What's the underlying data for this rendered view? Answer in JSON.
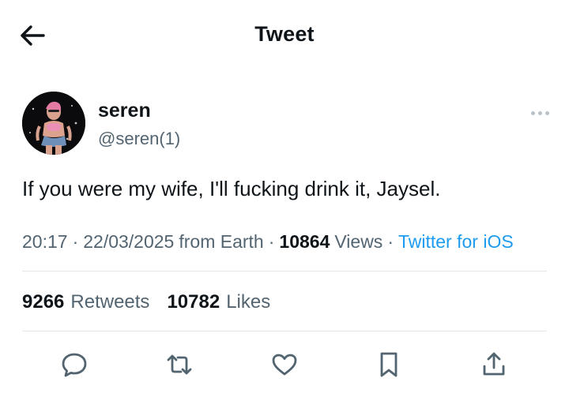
{
  "header": {
    "back_icon": "arrow-left-icon",
    "title": "Tweet"
  },
  "author": {
    "display_name": "seren",
    "handle": "@seren(1)",
    "avatar": "profile-photo"
  },
  "tweet": {
    "text": "If you were my wife, I'll fucking drink it, Jaysel."
  },
  "meta": {
    "time": "20:17",
    "separator": "·",
    "date": "22/03/2025",
    "location": "from Earth",
    "views_count": "10864",
    "views_label": "Views",
    "source": "Twitter for iOS",
    "source_color": "#1d9bf0"
  },
  "stats": {
    "retweets_count": "9266",
    "retweets_label": "Retweets",
    "likes_count": "10782",
    "likes_label": "Likes"
  },
  "actions": [
    {
      "icon": "reply-icon"
    },
    {
      "icon": "retweet-icon"
    },
    {
      "icon": "like-icon"
    },
    {
      "icon": "bookmark-icon"
    },
    {
      "icon": "share-icon"
    }
  ],
  "colors": {
    "text_primary": "#0f1419",
    "text_secondary": "#536471",
    "divider": "#e1e6ea"
  }
}
